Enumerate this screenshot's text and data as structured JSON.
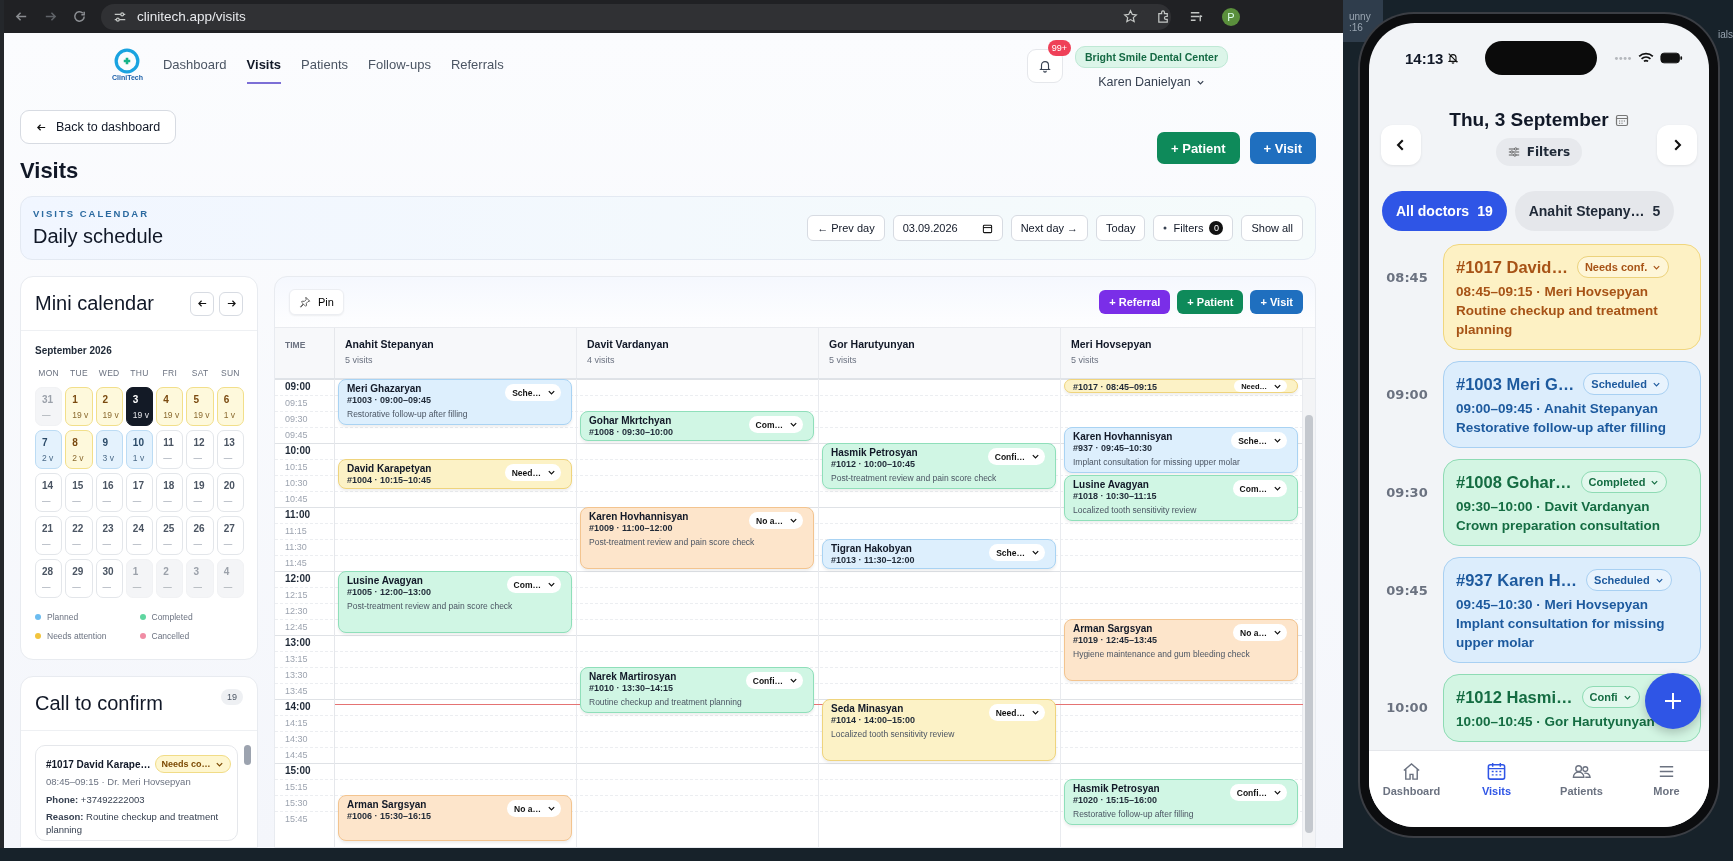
{
  "browser": {
    "url": "clinitech.app/visits",
    "profile": "P"
  },
  "nav": {
    "logo": "CliniTech",
    "links": [
      {
        "label": "Dashboard",
        "selected": false
      },
      {
        "label": "Visits",
        "selected": true
      },
      {
        "label": "Patients",
        "selected": false
      },
      {
        "label": "Follow-ups",
        "selected": false
      },
      {
        "label": "Referrals",
        "selected": false
      }
    ],
    "notifications": "99+",
    "clinic": "Bright Smile Dental Center",
    "user": "Karen Danielyan"
  },
  "page": {
    "back": "Back to dashboard",
    "title": "Visits",
    "actions": [
      {
        "label": "+ Patient",
        "kind": "patient"
      },
      {
        "label": "+ Visit",
        "kind": "visit"
      }
    ]
  },
  "calendar_header": {
    "eyebrow": "VISITS CALENDAR",
    "title": "Daily schedule",
    "prev": "← Prev day",
    "date": "03.09.2026",
    "next": "Next day →",
    "today": "Today",
    "filters": "Filters",
    "filters_count": "0",
    "show_all": "Show all"
  },
  "mini_calendar": {
    "title": "Mini calendar",
    "month": "September 2026",
    "weekdays": [
      "MON",
      "TUE",
      "WED",
      "THU",
      "FRI",
      "SAT",
      "SUN"
    ],
    "days": [
      {
        "day": "31",
        "count": "—",
        "kind": "outside",
        "selected": false
      },
      {
        "day": "1",
        "count": "19 v",
        "kind": "attention",
        "selected": false
      },
      {
        "day": "2",
        "count": "19 v",
        "kind": "attention",
        "selected": false
      },
      {
        "day": "3",
        "count": "19 v",
        "kind": "attention",
        "selected": true
      },
      {
        "day": "4",
        "count": "19 v",
        "kind": "attention",
        "selected": false
      },
      {
        "day": "5",
        "count": "19 v",
        "kind": "attention",
        "selected": false
      },
      {
        "day": "6",
        "count": "1 v",
        "kind": "attention",
        "selected": false
      },
      {
        "day": "7",
        "count": "2 v",
        "kind": "planned",
        "selected": false
      },
      {
        "day": "8",
        "count": "2 v",
        "kind": "attention",
        "selected": false
      },
      {
        "day": "9",
        "count": "3 v",
        "kind": "planned",
        "selected": false
      },
      {
        "day": "10",
        "count": "1 v",
        "kind": "planned",
        "selected": false
      },
      {
        "day": "11",
        "count": "—",
        "kind": "empty",
        "selected": false
      },
      {
        "day": "12",
        "count": "—",
        "kind": "empty",
        "selected": false
      },
      {
        "day": "13",
        "count": "—",
        "kind": "empty",
        "selected": false
      },
      {
        "day": "14",
        "count": "—",
        "kind": "empty",
        "selected": false
      },
      {
        "day": "15",
        "count": "—",
        "kind": "empty",
        "selected": false
      },
      {
        "day": "16",
        "count": "—",
        "kind": "empty",
        "selected": false
      },
      {
        "day": "17",
        "count": "—",
        "kind": "empty",
        "selected": false
      },
      {
        "day": "18",
        "count": "—",
        "kind": "empty",
        "selected": false
      },
      {
        "day": "19",
        "count": "—",
        "kind": "empty",
        "selected": false
      },
      {
        "day": "20",
        "count": "—",
        "kind": "empty",
        "selected": false
      },
      {
        "day": "21",
        "count": "—",
        "kind": "empty",
        "selected": false
      },
      {
        "day": "22",
        "count": "—",
        "kind": "empty",
        "selected": false
      },
      {
        "day": "23",
        "count": "—",
        "kind": "empty",
        "selected": false
      },
      {
        "day": "24",
        "count": "—",
        "kind": "empty",
        "selected": false
      },
      {
        "day": "25",
        "count": "—",
        "kind": "empty",
        "selected": false
      },
      {
        "day": "26",
        "count": "—",
        "kind": "empty",
        "selected": false
      },
      {
        "day": "27",
        "count": "—",
        "kind": "empty",
        "selected": false
      },
      {
        "day": "28",
        "count": "—",
        "kind": "empty",
        "selected": false
      },
      {
        "day": "29",
        "count": "—",
        "kind": "empty",
        "selected": false
      },
      {
        "day": "30",
        "count": "—",
        "kind": "empty",
        "selected": false
      },
      {
        "day": "1",
        "count": "—",
        "kind": "outside",
        "selected": false
      },
      {
        "day": "2",
        "count": "—",
        "kind": "outside",
        "selected": false
      },
      {
        "day": "3",
        "count": "—",
        "kind": "outside",
        "selected": false
      },
      {
        "day": "4",
        "count": "—",
        "kind": "outside",
        "selected": false
      }
    ],
    "legend": [
      {
        "label": "Planned",
        "color": "#6cbcf0"
      },
      {
        "label": "Completed",
        "color": "#5fd6a0"
      },
      {
        "label": "Needs attention",
        "color": "#f2c43d"
      },
      {
        "label": "Cancelled",
        "color": "#f08ca4"
      }
    ]
  },
  "call_to_confirm": {
    "title": "Call to confirm",
    "count": "19",
    "items": [
      {
        "title": "#1017 David Karape…",
        "status": "Needs co…",
        "time": "08:45–09:15 · Dr. Meri Hovsepyan",
        "phone": "**Phone:** +37492222003",
        "reason": "**Reason:** Routine checkup and treatment planning"
      }
    ]
  },
  "schedule": {
    "pin": "Pin",
    "actions": [
      {
        "label": "+ Referral",
        "kind": "referral"
      },
      {
        "label": "+ Patient",
        "kind": "patient"
      },
      {
        "label": "+ Visit",
        "kind": "visit"
      }
    ],
    "time_heading": "TIME",
    "times": [
      "09:00",
      "09:15",
      "09:30",
      "09:45",
      "10:00",
      "10:15",
      "10:30",
      "10:45",
      "11:00",
      "11:15",
      "11:30",
      "11:45",
      "12:00",
      "12:15",
      "12:30",
      "12:45",
      "13:00",
      "13:15",
      "13:30",
      "13:45",
      "14:00",
      "14:15",
      "14:30",
      "14:45",
      "15:00",
      "15:15",
      "15:30",
      "15:45"
    ],
    "doctors": [
      {
        "name": "Anahit Stepanyan",
        "visits": "5 visits",
        "events": [
          {
            "patient": "Meri Ghazaryan",
            "ref": "#1003 · 09:00–09:45",
            "reason": "Restorative follow-up after filling",
            "status": "Sche…",
            "kind": "scheduled"
          },
          {
            "patient": "David Karapetyan",
            "ref": "#1004 · 10:15–10:45",
            "status": "Need…",
            "kind": "attention"
          },
          {
            "patient": "Lusine Avagyan",
            "ref": "#1005 · 12:00–13:00",
            "reason": "Post-treatment review and pain score check",
            "status": "Com…",
            "kind": "completed"
          },
          {
            "patient": "Arman Sargsyan",
            "ref": "#1006 · 15:30–16:15",
            "status": "No a…",
            "kind": "noanswer"
          }
        ]
      },
      {
        "name": "Davit Vardanyan",
        "visits": "4 visits",
        "events": [
          {
            "patient": "Gohar Mkrtchyan",
            "ref": "#1008 · 09:30–10:00",
            "status": "Com…",
            "kind": "completed"
          },
          {
            "patient": "Karen Hovhannisyan",
            "ref": "#1009 · 11:00–12:00",
            "reason": "Post-treatment review and pain score check",
            "status": "No a…",
            "kind": "noanswer"
          },
          {
            "patient": "Narek Martirosyan",
            "ref": "#1010 · 13:30–14:15",
            "reason": "Routine checkup and treatment planning",
            "status": "Confi…",
            "kind": "confirmed"
          }
        ]
      },
      {
        "name": "Gor Harutyunyan",
        "visits": "5 visits",
        "events": [
          {
            "patient": "Hasmik Petrosyan",
            "ref": "#1012 · 10:00–10:45",
            "reason": "Post-treatment review and pain score check",
            "status": "Confi…",
            "kind": "confirmed"
          },
          {
            "patient": "Tigran Hakobyan",
            "ref": "#1013 · 11:30–12:00",
            "status": "Sche…",
            "kind": "scheduled"
          },
          {
            "patient": "Seda Minasyan",
            "ref": "#1014 · 14:00–15:00",
            "reason": "Localized tooth sensitivity review",
            "status": "Need…",
            "kind": "attention"
          }
        ]
      },
      {
        "name": "Meri Hovsepyan",
        "visits": "5 visits",
        "events": [
          {
            "ref": "#1017 · 08:45–09:15",
            "status": "Need…",
            "kind": "attention"
          },
          {
            "patient": "Karen Hovhannisyan",
            "ref": "#937 · 09:45–10:30",
            "reason": "Implant consultation for missing upper molar",
            "status": "Sche…",
            "kind": "scheduled"
          },
          {
            "patient": "Lusine Avagyan",
            "ref": "#1018 · 10:30–11:15",
            "reason": "Localized tooth sensitivity review",
            "status": "Com…",
            "kind": "completed"
          },
          {
            "patient": "Arman Sargsyan",
            "ref": "#1019 · 12:45–13:45",
            "reason": "Hygiene maintenance and gum bleeding check",
            "status": "No a…",
            "kind": "noanswer"
          },
          {
            "patient": "Hasmik Petrosyan",
            "ref": "#1020 · 15:15–16:00",
            "reason": "Restorative follow-up after filling",
            "status": "Confi…",
            "kind": "confirmed"
          }
        ]
      }
    ]
  },
  "desktop": {
    "fragments": [
      "unny",
      ":16",
      "ials"
    ]
  },
  "phone": {
    "clock": "14:13",
    "date": "Thu, 3 September",
    "filters": "Filters",
    "chips": [
      {
        "label": "All doctors",
        "count": "19",
        "selected": true
      },
      {
        "label": "Anahit Stepany…",
        "count": "5",
        "selected": false
      }
    ],
    "visits": [
      {
        "time": "08:45",
        "title": "#1017 David…",
        "status": "Needs conf.",
        "kind": "attention",
        "line": "08:45–09:15 · Meri Hovsepyan",
        "reason": "Routine checkup and treatment planning"
      },
      {
        "time": "09:00",
        "title": "#1003 Meri G…",
        "status": "Scheduled",
        "kind": "scheduled",
        "line": "09:00–09:45 · Anahit Stepanyan",
        "reason": "Restorative follow-up after filling"
      },
      {
        "time": "09:30",
        "title": "#1008 Gohar…",
        "status": "Completed",
        "kind": "completed",
        "line": "09:30–10:00 · Davit Vardanyan",
        "reason": "Crown preparation consultation"
      },
      {
        "time": "09:45",
        "title": "#937 Karen H…",
        "status": "Scheduled",
        "kind": "scheduled",
        "line": "09:45–10:30 · Meri Hovsepyan",
        "reason": "Implant consultation for missing upper molar"
      },
      {
        "time": "10:00",
        "title": "#1012 Hasmi…",
        "status": "Confi",
        "kind": "confirmed",
        "line": "10:00–10:45 · Gor Harutyunyan"
      }
    ],
    "tabs": [
      {
        "label": "Dashboard",
        "kind": "home",
        "selected": false
      },
      {
        "label": "Visits",
        "kind": "calendar",
        "selected": true
      },
      {
        "label": "Patients",
        "kind": "people",
        "selected": false
      },
      {
        "label": "More",
        "kind": "menu",
        "selected": false
      }
    ]
  }
}
